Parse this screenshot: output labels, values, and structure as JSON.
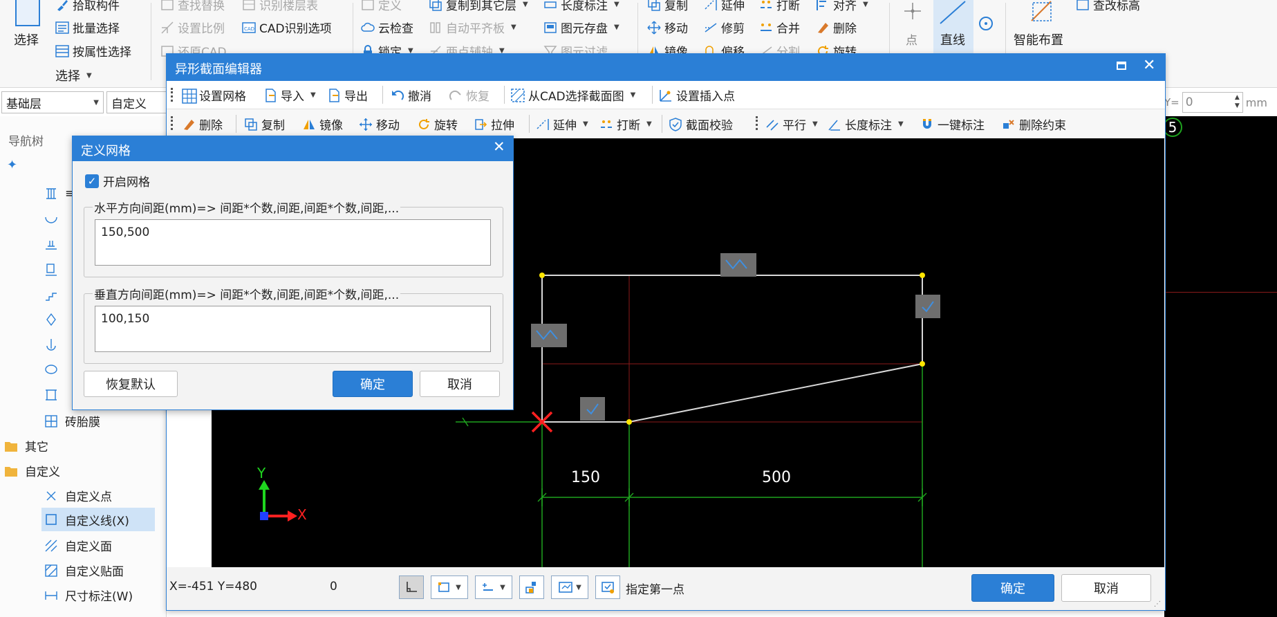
{
  "ribbon": {
    "select_label": "选择",
    "group_select_label": "选择",
    "items": {
      "pick_component": "拾取构件",
      "batch_select": "批量选择",
      "select_by_property": "按属性选择",
      "find_replace": "查找替换",
      "set_ratio": "设置比例",
      "restore_cad": "还原CAD",
      "identify_floor_table": "识别楼层表",
      "cad_recognition_options": "CAD识别选项",
      "define": "定义",
      "cloud_check": "云检查",
      "lock": "锁定",
      "copy_to_other_floor": "复制到其它层",
      "auto_flat_slab": "自动平齐板",
      "two_point_axis": "两点辅轴",
      "length_dim": "长度标注",
      "element_archive": "图元存盘",
      "element_filter": "图元过滤",
      "copy": "复制",
      "move": "移动",
      "mirror": "镜像",
      "extend": "延伸",
      "trim": "修剪",
      "offset": "偏移",
      "break": "打断",
      "merge": "合并",
      "split": "分割",
      "align": "对齐",
      "delete": "删除",
      "rotate": "旋转",
      "point": "点",
      "line": "直线",
      "smart_layout": "智能布置",
      "view_elevation": "查改标高"
    }
  },
  "floorbar": {
    "floor_value": "基础层",
    "type_value": "自定义",
    "y_label": "Y=",
    "y_value": "0",
    "unit": "mm"
  },
  "nav": {
    "header": "导航树",
    "items": {
      "ellipse": "≡",
      "cat_other": "其它",
      "cat_custom": "自定义",
      "brick_mold": "砖胎膜",
      "custom_point": "自定义点",
      "custom_line": "自定义线(X)",
      "custom_surface": "自定义面",
      "custom_paste": "自定义贴面",
      "dimension": "尺寸标注(W)"
    }
  },
  "editor": {
    "title": "异形截面编辑器",
    "toolbar1": {
      "set_grid": "设置网格",
      "import": "导入",
      "export": "导出",
      "undo": "撤消",
      "redo": "恢复",
      "from_cad": "从CAD选择截面图",
      "set_insert_point": "设置插入点"
    },
    "toolbar2": {
      "delete": "删除",
      "copy": "复制",
      "mirror": "镜像",
      "move": "移动",
      "rotate": "旋转",
      "stretch": "拉伸",
      "extend": "延伸",
      "break": "打断",
      "section_check": "截面校验",
      "parallel": "平行",
      "length_dim": "长度标注",
      "one_key_dim": "一键标注",
      "delete_constraint": "删除约束"
    },
    "canvas": {
      "dim_left": "150",
      "dim_right": "500",
      "axis_x": "X",
      "axis_y": "Y"
    },
    "status": {
      "coords": "X=-451 Y=480",
      "count": "0",
      "prompt": "指定第一点"
    },
    "ok": "确定",
    "cancel": "取消"
  },
  "dialog": {
    "title": "定义网格",
    "enable_grid_label": "开启网格",
    "enable_grid_checked": true,
    "h_legend": "水平方向间距(mm)=> 间距*个数,间距,间距*个数,间距,...",
    "h_value": "150,500",
    "v_legend": "垂直方向间距(mm)=> 间距*个数,间距,间距*个数,间距,...",
    "v_value": "100,150",
    "restore_default": "恢复默认",
    "ok": "确定",
    "cancel": "取消"
  },
  "right_strip": {
    "badge": "5"
  },
  "colors": {
    "accent": "#2b7fd6",
    "canvas_bg": "#000000",
    "grid_green": "#1fa31f",
    "grid_red": "#8b1a1a",
    "shape_white": "#d8d8d8",
    "vertex_yellow": "#ffe600",
    "origin_red": "#ff2020"
  }
}
